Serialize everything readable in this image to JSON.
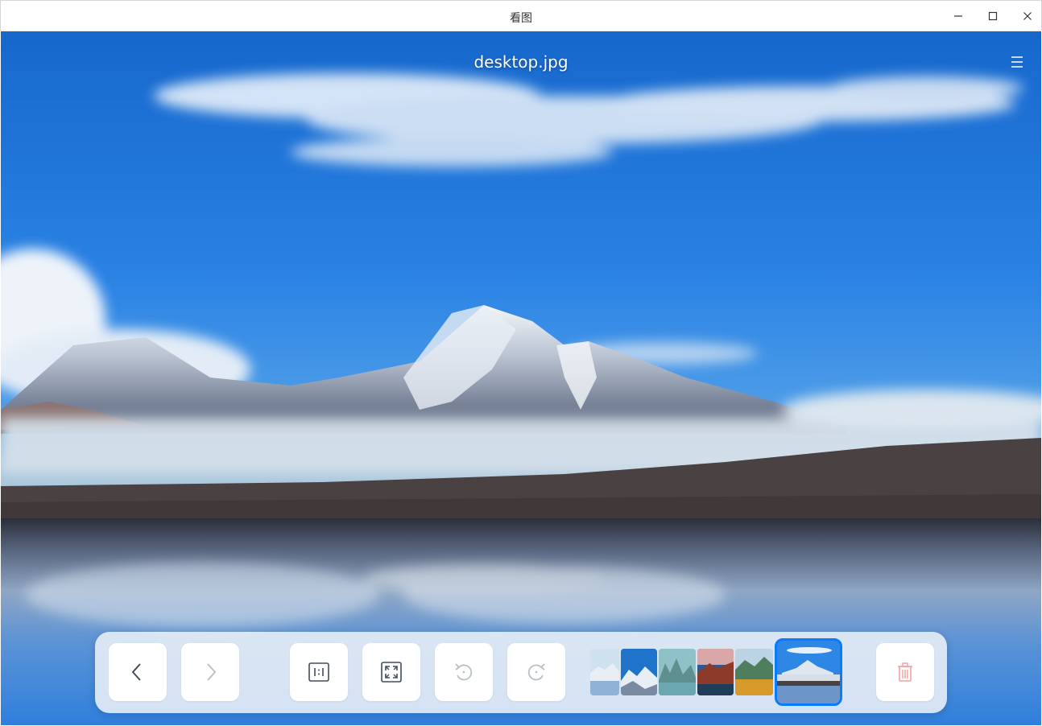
{
  "window": {
    "title": "看图",
    "minimize_icon": "minimize-icon",
    "maximize_icon": "maximize-icon",
    "close_icon": "close-icon"
  },
  "viewer": {
    "file_name": "desktop.jpg",
    "menu_icon": "hamburger-menu-icon"
  },
  "toolbar": {
    "buttons": [
      {
        "name": "previous-image-button",
        "icon": "chevron-left-icon",
        "enabled": true
      },
      {
        "name": "next-image-button",
        "icon": "chevron-right-icon",
        "enabled": false
      },
      {
        "name": "original-size-button",
        "icon": "one-to-one-icon",
        "enabled": true
      },
      {
        "name": "fit-to-window-button",
        "icon": "fit-window-icon",
        "enabled": true
      },
      {
        "name": "rotate-left-button",
        "icon": "rotate-counterclockwise-icon",
        "enabled": false
      },
      {
        "name": "rotate-right-button",
        "icon": "rotate-clockwise-icon",
        "enabled": false
      },
      {
        "name": "delete-button",
        "icon": "trash-icon",
        "enabled": false
      }
    ],
    "thumbnails_count": 6,
    "active_thumbnail_index": 5
  },
  "colors": {
    "accent": "#0a7bff",
    "delete_disabled": "#f2a0a0",
    "icon_enabled": "#414d5c",
    "icon_disabled": "#b9c0c8"
  }
}
